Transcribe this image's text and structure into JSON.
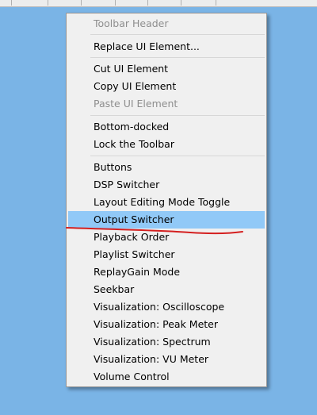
{
  "menu": {
    "items": [
      {
        "label": "Toolbar Header",
        "disabled": true
      },
      {
        "label": "Replace UI Element..."
      },
      {
        "label": "Cut UI Element"
      },
      {
        "label": "Copy UI Element"
      },
      {
        "label": "Paste UI Element",
        "disabled": true
      },
      {
        "label": "Bottom-docked"
      },
      {
        "label": "Lock the Toolbar"
      },
      {
        "label": "Buttons"
      },
      {
        "label": "DSP Switcher"
      },
      {
        "label": "Layout Editing Mode Toggle"
      },
      {
        "label": "Output Switcher",
        "highlighted": true
      },
      {
        "label": "Playback Order"
      },
      {
        "label": "Playlist Switcher"
      },
      {
        "label": "ReplayGain Mode"
      },
      {
        "label": "Seekbar"
      },
      {
        "label": "Visualization: Oscilloscope"
      },
      {
        "label": "Visualization: Peak Meter"
      },
      {
        "label": "Visualization: Spectrum"
      },
      {
        "label": "Visualization: VU Meter"
      },
      {
        "label": "Volume Control"
      }
    ]
  },
  "colors": {
    "background": "#7ab4e6",
    "menu_background": "#f0f0f0",
    "highlight": "#91c9f7",
    "disabled_text": "#8e8e8e",
    "annotation_stroke": "#d42020"
  }
}
